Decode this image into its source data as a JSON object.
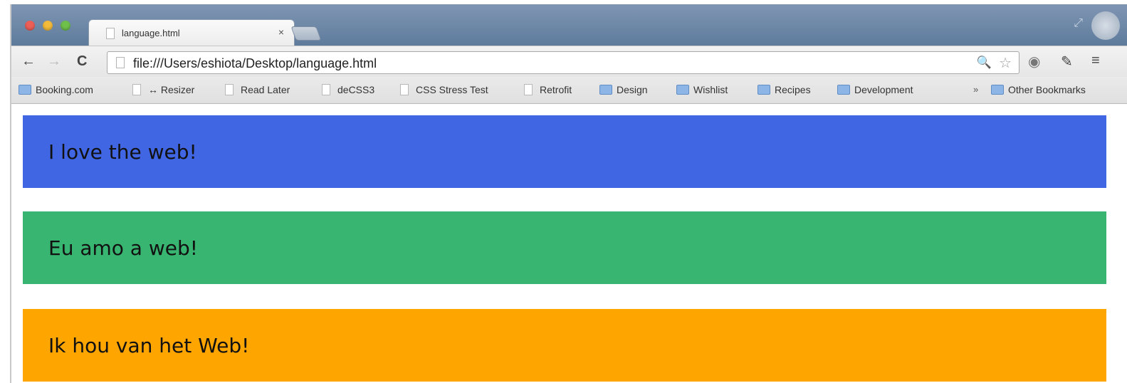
{
  "tab": {
    "title": "language.html",
    "close_glyph": "×"
  },
  "toolbar": {
    "back_glyph": "←",
    "forward_glyph": "→",
    "reload_glyph": "C",
    "url": "file:///Users/eshiota/Desktop/language.html",
    "zoom_glyph": "🔍",
    "star_glyph": "☆",
    "ext_glyph": "◉",
    "wrench_glyph": "✎",
    "menu_glyph": "≡"
  },
  "bookmarks": {
    "items": [
      {
        "label": "Booking.com",
        "icon": "folder-icon"
      },
      {
        "label": "↔ Resizer",
        "icon": "page-icon"
      },
      {
        "label": "Read Later",
        "icon": "page-icon"
      },
      {
        "label": "deCSS3",
        "icon": "page-icon"
      },
      {
        "label": "CSS Stress Test",
        "icon": "page-icon"
      },
      {
        "label": "Retrofit",
        "icon": "page-icon"
      },
      {
        "label": "Design",
        "icon": "folder-icon"
      },
      {
        "label": "Wishlist",
        "icon": "folder-icon"
      },
      {
        "label": "Recipes",
        "icon": "folder-icon"
      },
      {
        "label": "Development",
        "icon": "folder-icon"
      }
    ],
    "overflow_glyph": "»",
    "other": "Other Bookmarks"
  },
  "content": {
    "banners": [
      {
        "text": "I love the web!",
        "color": "#4166e3"
      },
      {
        "text": "Eu amo a web!",
        "color": "#38b571"
      },
      {
        "text": "Ik hou van het Web!",
        "color": "#fea500"
      }
    ]
  },
  "colors": {
    "titlebar": "#6b86a6",
    "toolbar": "#ececec"
  }
}
